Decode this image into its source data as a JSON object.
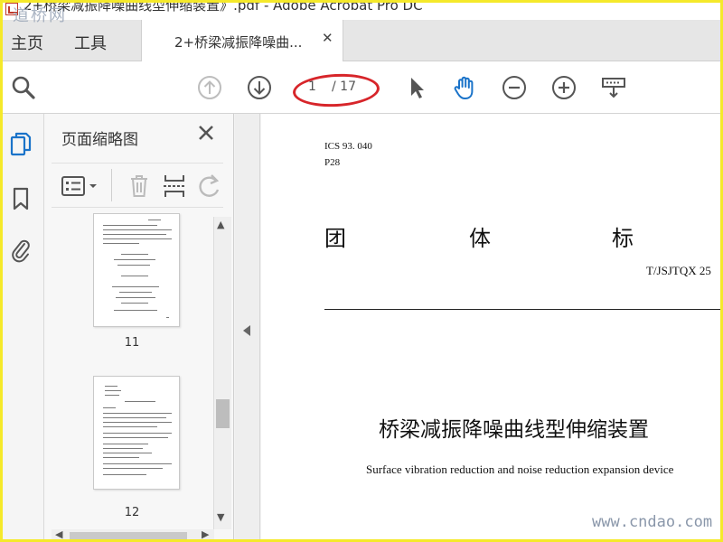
{
  "window": {
    "title": "2+桥梁减振降噪曲线型伸缩装置》.pdf - Adobe Acrobat Pro DC",
    "watermark_top": "道桥网",
    "watermark_bottom": "www.cndao.com"
  },
  "tabs": {
    "home": "主页",
    "tools": "工具",
    "document": "2+桥梁减振降噪曲...",
    "close_glyph": "✕"
  },
  "toolbar": {
    "current_page": "1",
    "total_pages": "/ 17",
    "accent_color": "#1a73c9",
    "highlight_color": "#d7252a"
  },
  "thumbnail_panel": {
    "title": "页面缩略图",
    "close_glyph": "✕",
    "pages": [
      {
        "label": "11"
      },
      {
        "label": "12"
      }
    ]
  },
  "document": {
    "ics": "ICS 93. 040",
    "ccs": "P28",
    "standard_words": [
      "团",
      "体",
      "标"
    ],
    "standard_no": "T/JSJTQX 25",
    "title": "桥梁减振降噪曲线型伸缩装置",
    "subtitle": "Surface vibration reduction and noise reduction expansion device"
  }
}
